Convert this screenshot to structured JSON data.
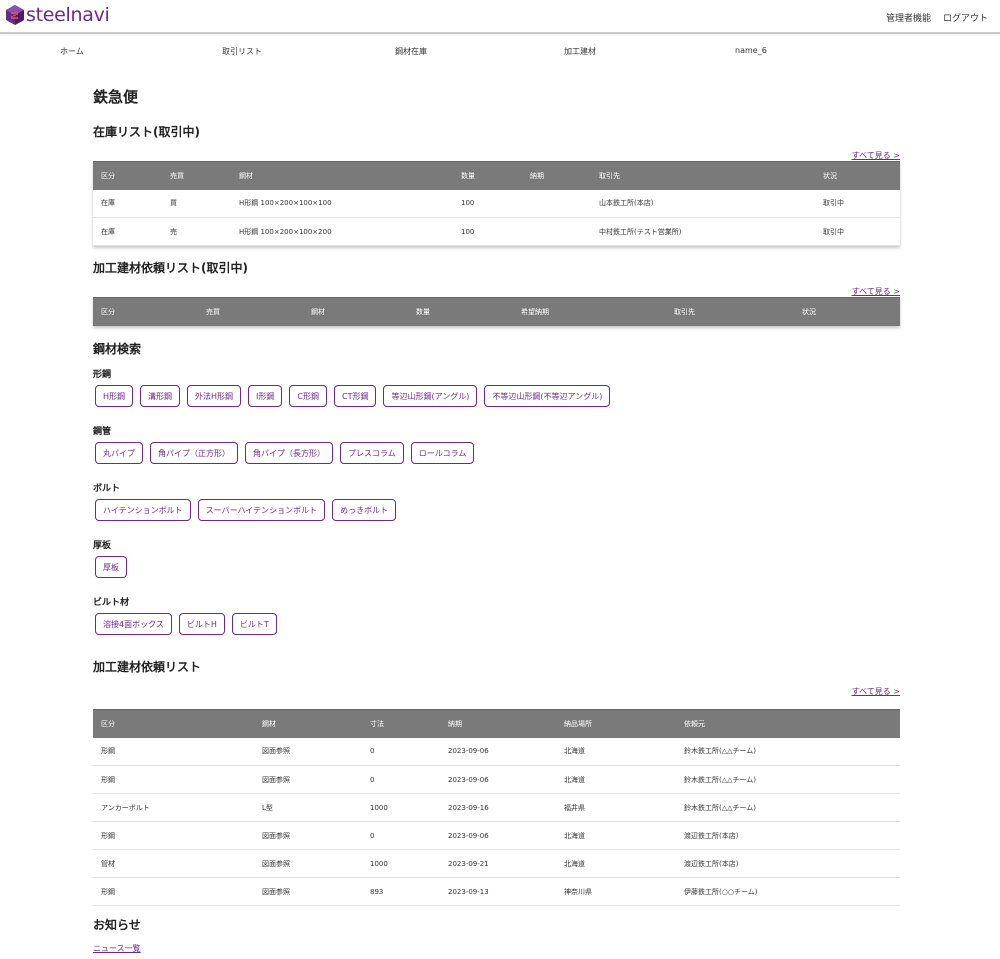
{
  "brand": {
    "name": "steelnavi",
    "color": "#6a2a88",
    "icon": "cube-logo-icon"
  },
  "topnav": {
    "admin": "管理者機能",
    "logout": "ログアウト"
  },
  "mainnav": [
    "ホーム",
    "取引リスト",
    "鋼材在庫",
    "加工建材",
    "name_6"
  ],
  "page_title": "鉄急便",
  "stock": {
    "title": "在庫リスト(取引中)",
    "see_all": "すべて見る >",
    "headers": [
      "区分",
      "売買",
      "鋼材",
      "数量",
      "納期",
      "取引先",
      "状況"
    ],
    "rows": [
      [
        "在庫",
        "買",
        "H形鋼 100×200×100×100",
        "100",
        "",
        "山本鉄工所(本店)",
        "取引中"
      ],
      [
        "在庫",
        "売",
        "H形鋼 100×200×100×200",
        "100",
        "",
        "中村鉄工所(テスト営業所)",
        "取引中"
      ]
    ]
  },
  "proc_active": {
    "title": "加工建材依頼リスト(取引中)",
    "see_all": "すべて見る >",
    "headers": [
      "区分",
      "売買",
      "鋼材",
      "数量",
      "希望納期",
      "取引先",
      "状況"
    ]
  },
  "search": {
    "title": "鋼材検索",
    "categories": [
      {
        "label": "形鋼",
        "items": [
          "H形鋼",
          "溝形鋼",
          "外法H形鋼",
          "I形鋼",
          "C形鋼",
          "CT形鋼",
          "等辺山形鋼(アングル)",
          "不等辺山形鋼(不等辺アングル)"
        ]
      },
      {
        "label": "鋼管",
        "items": [
          "丸パイプ",
          "角パイプ（正方形）",
          "角パイプ（長方形）",
          "プレスコラム",
          "ロールコラム"
        ]
      },
      {
        "label": "ボルト",
        "items": [
          "ハイテンションボルト",
          "スーパーハイテンションボルト",
          "めっきボルト"
        ]
      },
      {
        "label": "厚板",
        "items": [
          "厚板"
        ]
      },
      {
        "label": "ビルト材",
        "items": [
          "溶接4面ボックス",
          "ビルトH",
          "ビルトT"
        ]
      }
    ]
  },
  "proc_list": {
    "title": "加工建材依頼リスト",
    "see_all": "すべて見る >",
    "headers": [
      "区分",
      "鋼材",
      "寸法",
      "納期",
      "納品場所",
      "依頼元"
    ],
    "rows": [
      [
        "形鋼",
        "図面参照",
        "0",
        "2023-09-06",
        "北海道",
        "鈴木鉄工所(△△チーム)"
      ],
      [
        "形鋼",
        "図面参照",
        "0",
        "2023-09-06",
        "北海道",
        "鈴木鉄工所(△△チーム)"
      ],
      [
        "アンカーボルト",
        "L型",
        "1000",
        "2023-09-16",
        "福井県",
        "鈴木鉄工所(△△チーム)"
      ],
      [
        "形鋼",
        "図面参照",
        "0",
        "2023-09-06",
        "北海道",
        "渡辺鉄工所(本店)"
      ],
      [
        "管材",
        "図面参照",
        "1000",
        "2023-09-21",
        "北海道",
        "渡辺鉄工所(本店)"
      ],
      [
        "形鋼",
        "図面参照",
        "893",
        "2023-09-13",
        "神奈川県",
        "伊藤鉄工所(○○チーム)"
      ]
    ]
  },
  "news": {
    "title": "お知らせ",
    "link": "ニュース一覧"
  }
}
